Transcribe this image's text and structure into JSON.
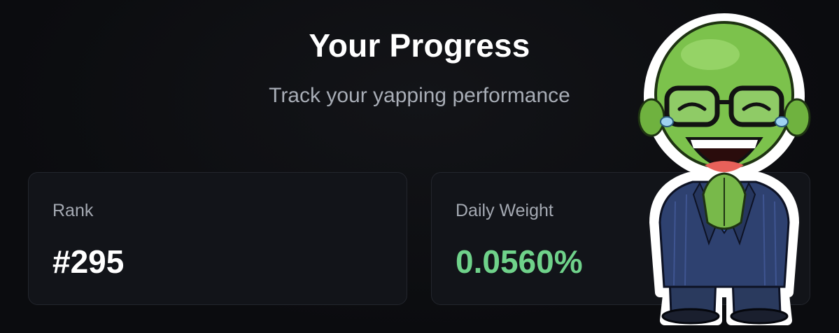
{
  "header": {
    "title": "Your Progress",
    "subtitle": "Track your yapping performance"
  },
  "stats": [
    {
      "label": "Rank",
      "value": "#295"
    },
    {
      "label": "Daily Weight",
      "value": "0.0560%",
      "value_color": "#6fd28a"
    }
  ],
  "colors": {
    "background": "#0b0c0f",
    "card_background": "#121419",
    "card_border": "#23262d",
    "accent_green": "#6fd28a",
    "muted_text": "#a8adb6"
  },
  "mascot": {
    "icon": "laughing-bald-man-in-suit-sticker"
  }
}
